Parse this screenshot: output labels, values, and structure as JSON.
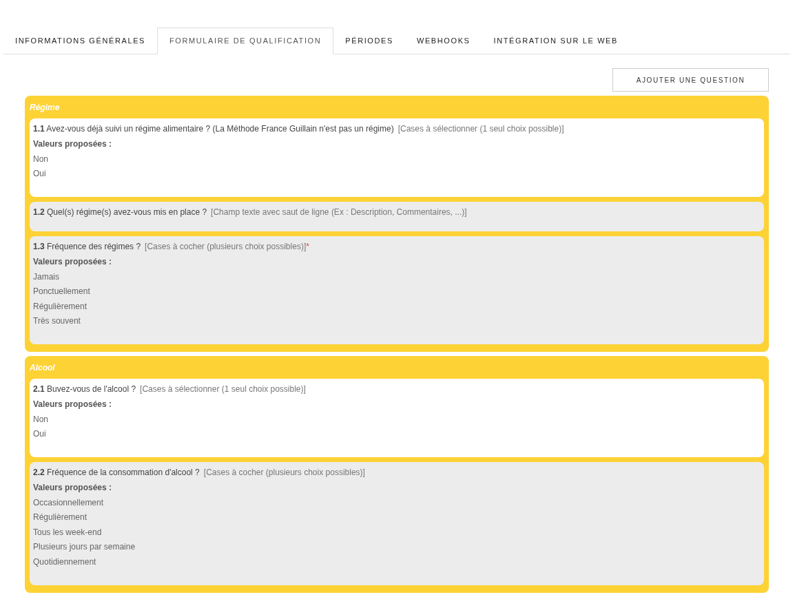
{
  "tabs": [
    {
      "label": "INFORMATIONS GÉNÉRALES",
      "selected": false
    },
    {
      "label": "FORMULAIRE DE QUALIFICATION",
      "selected": true
    },
    {
      "label": "PÉRIODES",
      "selected": false
    },
    {
      "label": "WEBHOOKS",
      "selected": false
    },
    {
      "label": "INTÉGRATION SUR LE WEB",
      "selected": false
    }
  ],
  "add_button": "AJOUTER UNE QUESTION",
  "sections": [
    {
      "title": "Régime",
      "questions": [
        {
          "number": "1.1",
          "text": "Avez-vous déjà suivi un régime alimentaire ? (La Méthode France Guillain n'est pas un régime)",
          "type": "[Cases à sélectionner (1 seul choix possible)]",
          "highlighted": true,
          "values_label": "Valeurs proposées :",
          "values": [
            "Non",
            "Oui"
          ]
        },
        {
          "number": "1.2",
          "text": "Quel(s) régime(s) avez-vous mis en place ?",
          "type": "[Champ texte avec saut de ligne (Ex : Description, Commentaires, ...)]",
          "highlighted": false
        },
        {
          "number": "1.3",
          "text": "Fréquence des régimes ?",
          "type": "[Cases à cocher (plusieurs choix possibles)]",
          "required_mark": "*",
          "highlighted": false,
          "values_label": "Valeurs proposées :",
          "values": [
            "Jamais",
            "Ponctuellement",
            "Régulièrement",
            "Très souvent"
          ]
        }
      ]
    },
    {
      "title": "Alcool",
      "questions": [
        {
          "number": "2.1",
          "text": "Buvez-vous de l'alcool ?",
          "type": "[Cases à sélectionner (1 seul choix possible)]",
          "highlighted": true,
          "values_label": "Valeurs proposées :",
          "values": [
            "Non",
            "Oui"
          ]
        },
        {
          "number": "2.2",
          "text": "Fréquence de la consommation d'alcool ?",
          "type": "[Cases à cocher (plusieurs choix possibles)]",
          "highlighted": false,
          "values_label": "Valeurs proposées :",
          "values": [
            "Occasionnellement",
            "Régulièrement",
            "Tous les week-end",
            "Plusieurs jours par semaine",
            "Quotidiennement"
          ]
        }
      ]
    }
  ]
}
